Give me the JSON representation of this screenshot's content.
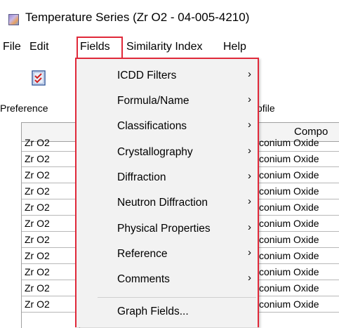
{
  "window": {
    "title": "Temperature Series (Zr O2 - 04-005-4210)"
  },
  "menubar": {
    "items": [
      {
        "label": "File"
      },
      {
        "label": "Edit"
      },
      {
        "label": "Fields"
      },
      {
        "label": "Similarity Index"
      },
      {
        "label": "Help"
      }
    ]
  },
  "toolbar": {
    "preferences_label": "Preference",
    "profile_label": "ofile"
  },
  "grid": {
    "column_header": "Compo",
    "rows": [
      {
        "formula": "Zr O2",
        "name": "conium Oxide"
      },
      {
        "formula": "Zr O2",
        "name": "conium Oxide"
      },
      {
        "formula": "Zr O2",
        "name": "conium Oxide"
      },
      {
        "formula": "Zr O2",
        "name": "conium Oxide"
      },
      {
        "formula": "Zr O2",
        "name": "conium Oxide"
      },
      {
        "formula": "Zr O2",
        "name": "conium Oxide"
      },
      {
        "formula": "Zr O2",
        "name": "conium Oxide"
      },
      {
        "formula": "Zr O2",
        "name": "conium Oxide"
      },
      {
        "formula": "Zr O2",
        "name": "conium Oxide"
      },
      {
        "formula": "Zr O2",
        "name": "conium Oxide"
      },
      {
        "formula": "Zr O2",
        "name": "conium Oxide"
      }
    ]
  },
  "fields_menu": {
    "items": [
      {
        "label": "ICDD Filters",
        "arrow": "›"
      },
      {
        "label": "Formula/Name",
        "arrow": "›"
      },
      {
        "label": "Classifications",
        "arrow": "›"
      },
      {
        "label": "Crystallography",
        "arrow": "›"
      },
      {
        "label": "Diffraction",
        "arrow": "›"
      },
      {
        "label": "Neutron Diffraction",
        "arrow": "›"
      },
      {
        "label": "Physical Properties",
        "arrow": "›"
      },
      {
        "label": "Reference",
        "arrow": "›"
      },
      {
        "label": "Comments",
        "arrow": "›"
      },
      {
        "label": "Graph Fields..."
      }
    ]
  },
  "colors": {
    "highlight_border": "#e0293a",
    "menu_bg": "#f2f2f2"
  }
}
